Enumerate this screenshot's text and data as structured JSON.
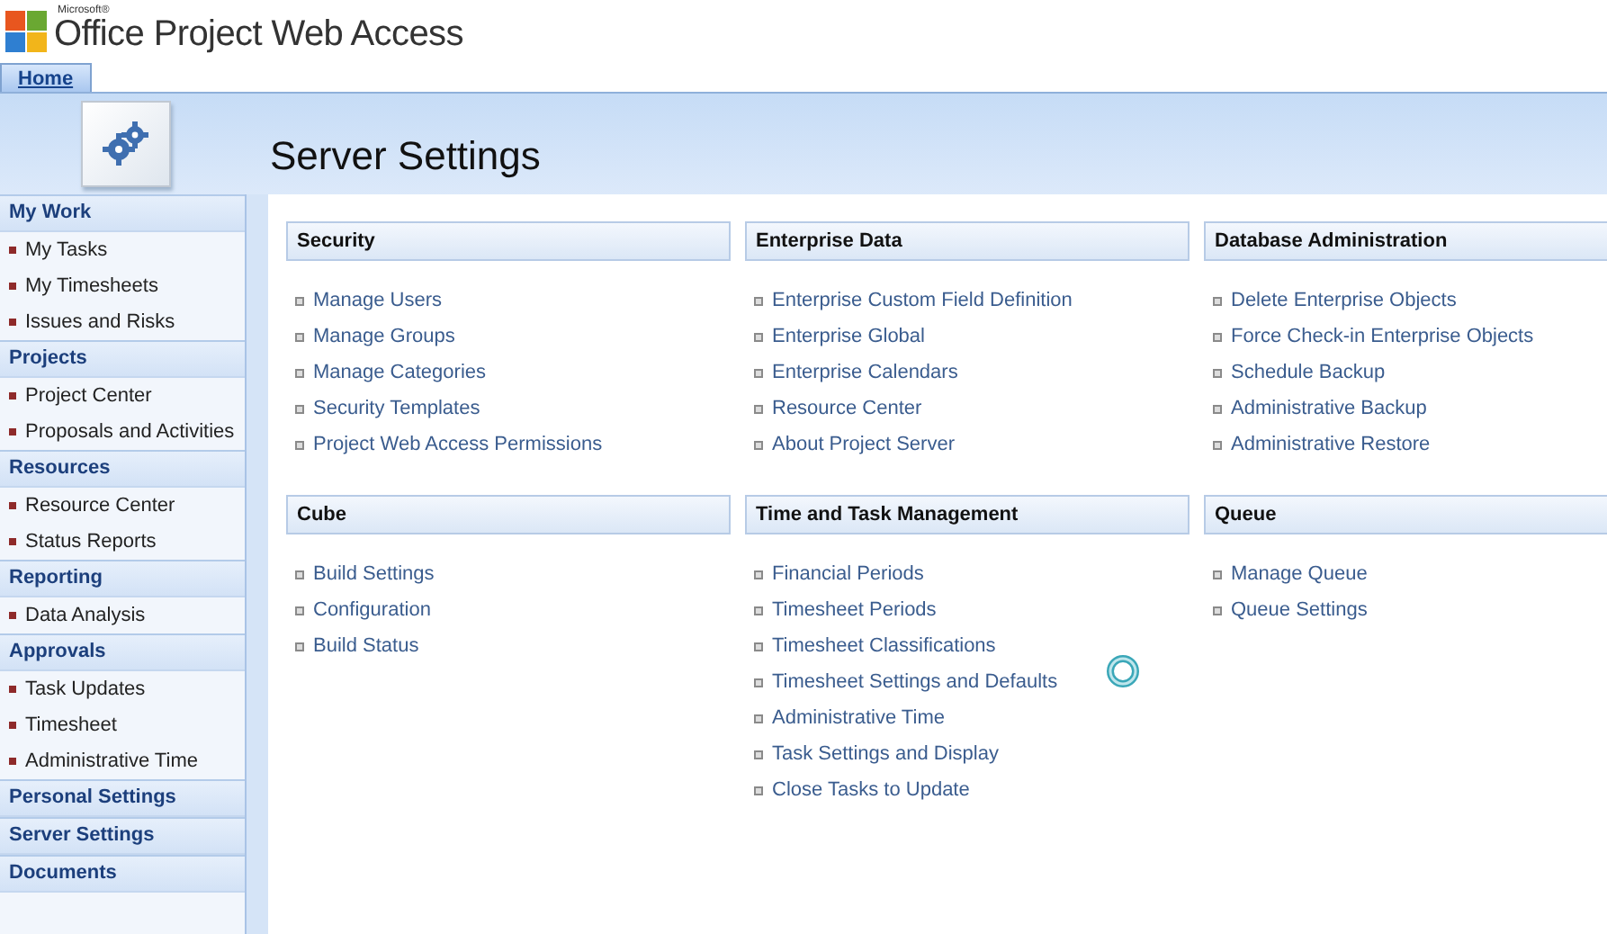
{
  "header": {
    "brand_small": "Microsoft®",
    "brand": "Office Project Web Access"
  },
  "tabs": [
    {
      "label": "Home",
      "selected": true
    }
  ],
  "page_title": "Server Settings",
  "sidebar": [
    {
      "heading": "My Work",
      "items": [
        "My Tasks",
        "My Timesheets",
        "Issues and Risks"
      ]
    },
    {
      "heading": "Projects",
      "items": [
        "Project Center",
        "Proposals and Activities"
      ]
    },
    {
      "heading": "Resources",
      "items": [
        "Resource Center",
        "Status Reports"
      ]
    },
    {
      "heading": "Reporting",
      "items": [
        "Data Analysis"
      ]
    },
    {
      "heading": "Approvals",
      "items": [
        "Task Updates",
        "Timesheet",
        "Administrative Time"
      ]
    },
    {
      "heading": "Personal Settings"
    },
    {
      "heading": "Server Settings"
    },
    {
      "heading": "Documents"
    }
  ],
  "sections": [
    {
      "title": "Security",
      "links": [
        "Manage Users",
        "Manage Groups",
        "Manage Categories",
        "Security Templates",
        "Project Web Access Permissions"
      ]
    },
    {
      "title": "Enterprise Data",
      "links": [
        "Enterprise Custom Field Definition",
        "Enterprise Global",
        "Enterprise Calendars",
        "Resource Center",
        "About Project Server"
      ]
    },
    {
      "title": "Database Administration",
      "links": [
        "Delete Enterprise Objects",
        "Force Check-in Enterprise Objects",
        "Schedule Backup",
        "Administrative Backup",
        "Administrative Restore"
      ]
    },
    {
      "title": "Cube",
      "links": [
        "Build Settings",
        "Configuration",
        "Build Status"
      ]
    },
    {
      "title": "Time and Task Management",
      "links": [
        "Financial Periods",
        "Timesheet Periods",
        "Timesheet Classifications",
        "Timesheet Settings and Defaults",
        "Administrative Time",
        "Task Settings and Display",
        "Close Tasks to Update"
      ]
    },
    {
      "title": "Queue",
      "links": [
        "Manage Queue",
        "Queue Settings"
      ]
    }
  ],
  "loading": true
}
